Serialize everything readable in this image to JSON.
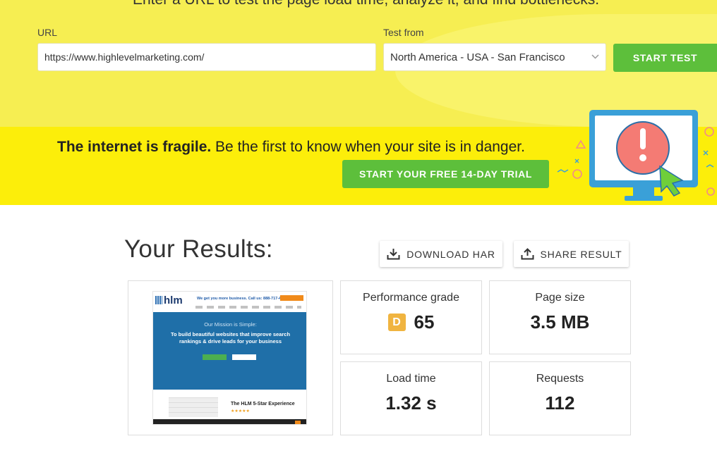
{
  "header": {
    "tagline": "Enter a URL to test the page load time, analyze it, and find bottlenecks."
  },
  "form": {
    "url_label": "URL",
    "url_value": "https://www.highlevelmarketing.com/",
    "location_label": "Test from",
    "location_value": "North America - USA - San Francisco",
    "start_label": "START TEST"
  },
  "promo": {
    "bold_text": "The internet is fragile.",
    "text": " Be the first to know when your site is in danger.",
    "trial_label": "START YOUR FREE 14-DAY TRIAL"
  },
  "results": {
    "title": "Your Results:",
    "download_label": "DOWNLOAD HAR",
    "share_label": "SHARE RESULT",
    "thumbnail": {
      "logo": "hlm",
      "tagline": "We get you more business. Call us: 888-717-4249",
      "mission": "Our Mission is Simple:",
      "headline": "To build beautiful websites that improve search rankings & drive leads for your business",
      "experience": "The HLM 5-Star Experience",
      "stars": "★★★★★"
    },
    "stats": [
      {
        "label": "Performance grade",
        "grade": "D",
        "value": "65"
      },
      {
        "label": "Page size",
        "value": "3.5 MB"
      },
      {
        "label": "Load time",
        "value": "1.32 s"
      },
      {
        "label": "Requests",
        "value": "112"
      }
    ]
  },
  "colors": {
    "form_band": "#f6ee52",
    "promo_band": "#fcee0a",
    "button_green": "#5dbf3b",
    "grade_badge": "#f0b440"
  },
  "icons": {
    "download": "download-icon",
    "share": "share-icon",
    "select_arrow": "chevron-down-icon",
    "monitor": "monitor-alert-icon"
  }
}
